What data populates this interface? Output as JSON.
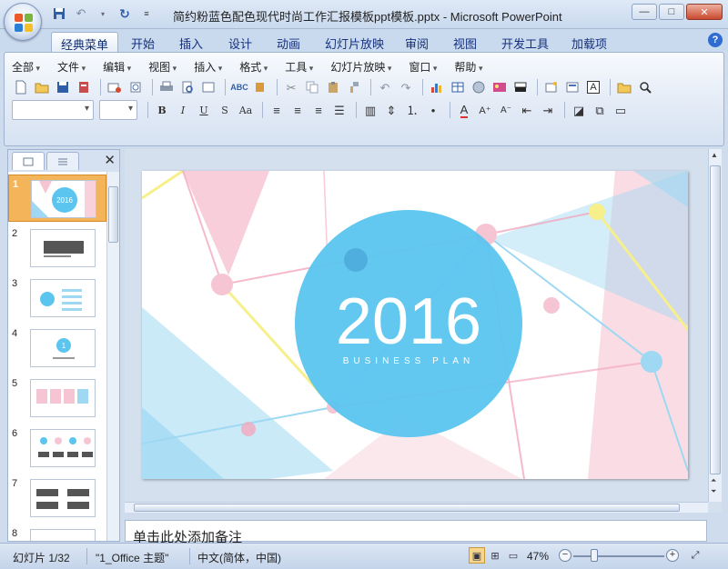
{
  "window": {
    "title": "简约粉蓝色配色现代时尚工作汇报模板ppt模板.pptx - Microsoft PowerPoint",
    "minimize": "—",
    "maximize": "□",
    "close": "✕"
  },
  "ribbon_tabs": [
    "经典菜单",
    "开始",
    "插入",
    "设计",
    "动画",
    "幻灯片放映",
    "审阅",
    "视图",
    "开发工具",
    "加载项"
  ],
  "help": "?",
  "menus": [
    "全部",
    "文件",
    "编辑",
    "视图",
    "插入",
    "格式",
    "工具",
    "幻灯片放映",
    "窗口",
    "帮助"
  ],
  "toolbar_icons": {
    "row1": [
      "new-icon",
      "open-icon",
      "save-icon",
      "permission-icon",
      "email-icon",
      "publish-icon",
      "print-icon",
      "print-preview-icon",
      "research-icon",
      "spelling-icon",
      "cut-icon",
      "copy-icon",
      "paste-icon",
      "format-painter-icon",
      "undo-icon",
      "redo-icon",
      "chart-icon",
      "table-icon",
      "clip-art-icon",
      "picture-icon",
      "color-grayscale-icon",
      "new-slide-icon",
      "layout-icon",
      "text-box-icon",
      "folder-icon",
      "zoom-icon"
    ],
    "row2": [
      "bold-icon",
      "italic-icon",
      "underline-icon",
      "strikethrough-icon",
      "change-case-icon",
      "align-left-icon",
      "align-center-icon",
      "align-right-icon",
      "justify-icon",
      "columns-icon",
      "line-spacing-icon",
      "numbering-icon",
      "bullets-icon",
      "font-color-icon",
      "increase-font-icon",
      "decrease-font-icon",
      "decrease-indent-icon",
      "increase-indent-icon",
      "shapes-icon",
      "arrange-icon",
      "quick-styles-icon"
    ]
  },
  "slide_panel": {
    "selected": 1,
    "thumbnails": [
      {
        "num": "1",
        "label": "2016"
      },
      {
        "num": "2",
        "label": ""
      },
      {
        "num": "3",
        "label": ""
      },
      {
        "num": "4",
        "label": "1"
      },
      {
        "num": "5",
        "label": ""
      },
      {
        "num": "6",
        "label": ""
      },
      {
        "num": "7",
        "label": ""
      },
      {
        "num": "8",
        "label": ""
      }
    ]
  },
  "slide": {
    "year": "2016",
    "subtitle": "BUSINESS PLAN",
    "colors": {
      "circle": "#5bc5ef",
      "pink": "#f6c5d3",
      "blue": "#9ed8f2",
      "yellow": "#f6ef8a"
    }
  },
  "notes_placeholder": "单击此处添加备注",
  "status": {
    "slide_counter": "幻灯片 1/32",
    "theme": "\"1_Office 主题\"",
    "language": "中文(简体，中国)",
    "zoom": "47%"
  }
}
